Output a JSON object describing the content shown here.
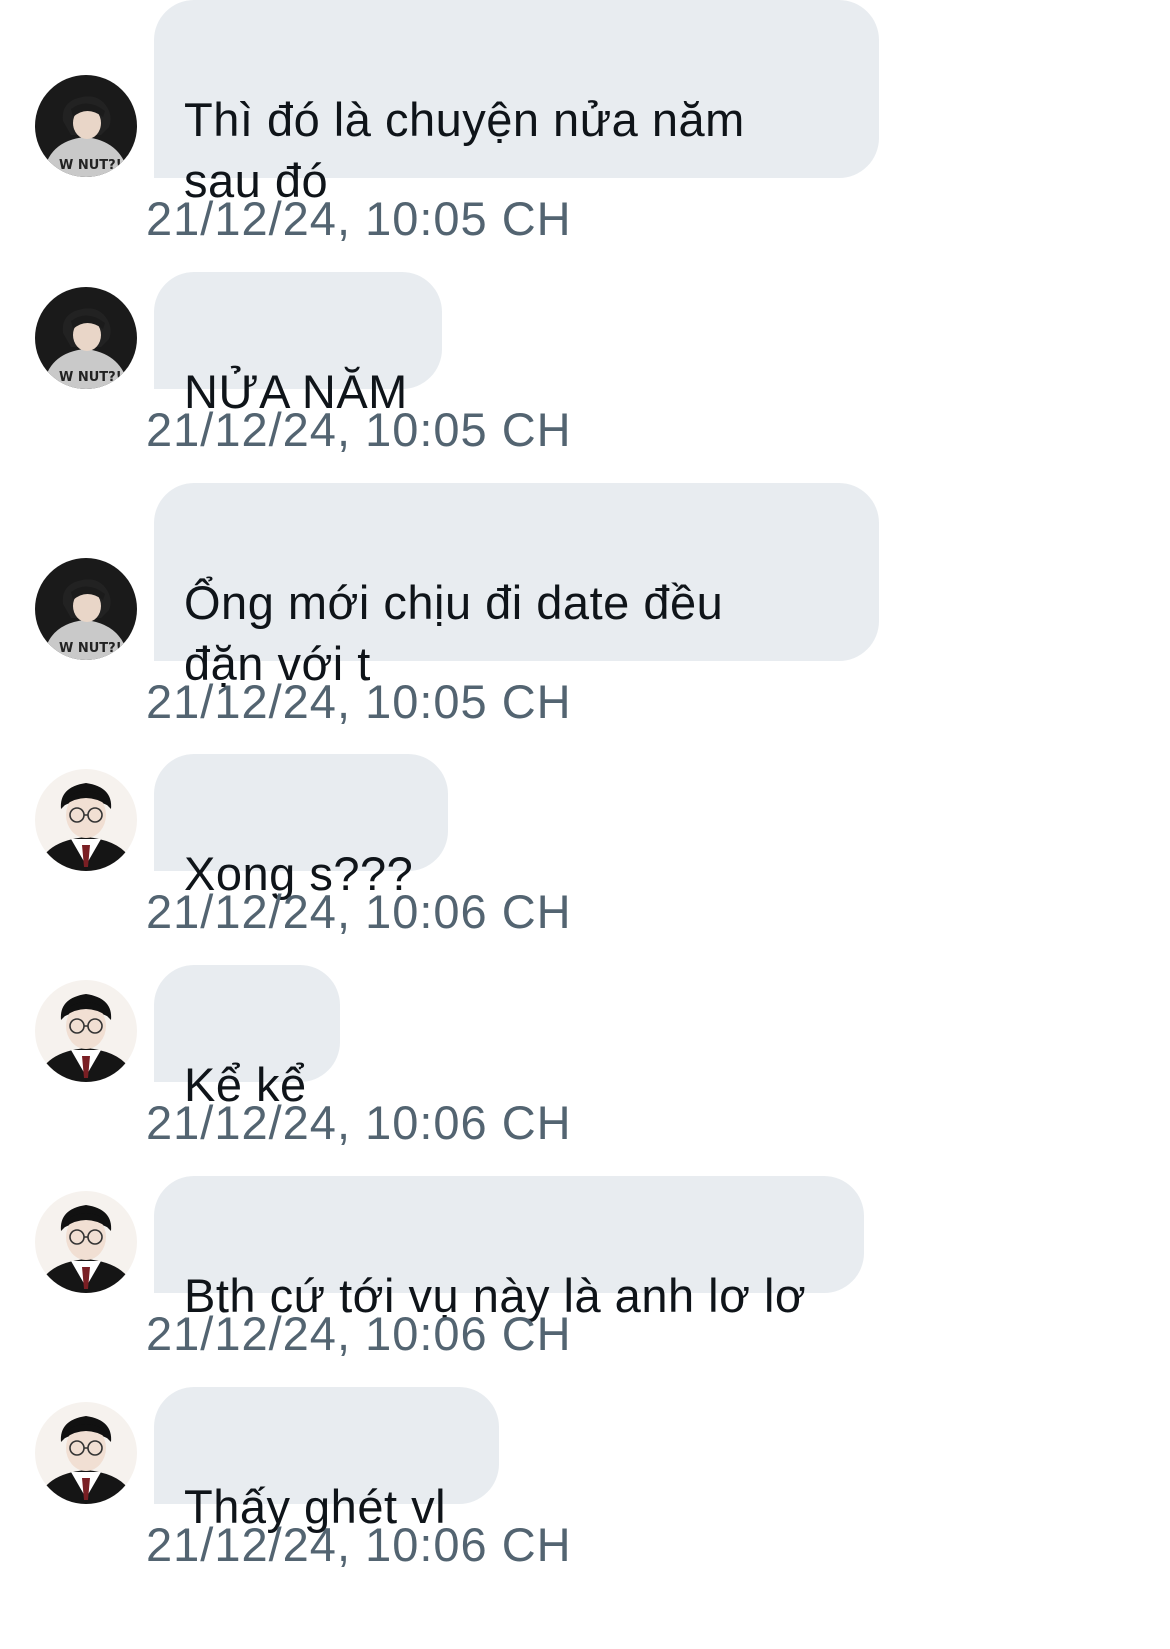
{
  "messages": [
    {
      "sender": "a",
      "text": "Thì đó là chuyện nửa năm\nsau đó",
      "time": "21/12/24, 10:05 CH"
    },
    {
      "sender": "a",
      "text": "NỬA NĂM",
      "time": "21/12/24, 10:05 CH"
    },
    {
      "sender": "a",
      "text": "Ổng mới chịu đi date đều\nđặn với t",
      "time": "21/12/24, 10:05 CH"
    },
    {
      "sender": "b",
      "text": "Xong s???",
      "time": "21/12/24, 10:06 CH"
    },
    {
      "sender": "b",
      "text": "Kể kể",
      "time": "21/12/24, 10:06 CH"
    },
    {
      "sender": "b",
      "text": "Bth cứ tới vụ này là anh lơ lơ",
      "time": "21/12/24, 10:06 CH"
    },
    {
      "sender": "b",
      "text": "Thấy ghét vl",
      "time": "21/12/24, 10:06 CH"
    }
  ],
  "avatars": {
    "a": {
      "icon": "avatar-hoodie-person-icon",
      "shirt_text": "W NUT?!"
    },
    "b": {
      "icon": "avatar-uniform-glasses-person-icon"
    }
  },
  "colors": {
    "bubble": "#e8ecf0",
    "message_text": "#0f1419",
    "timestamp_text": "#536471",
    "background": "#ffffff"
  }
}
